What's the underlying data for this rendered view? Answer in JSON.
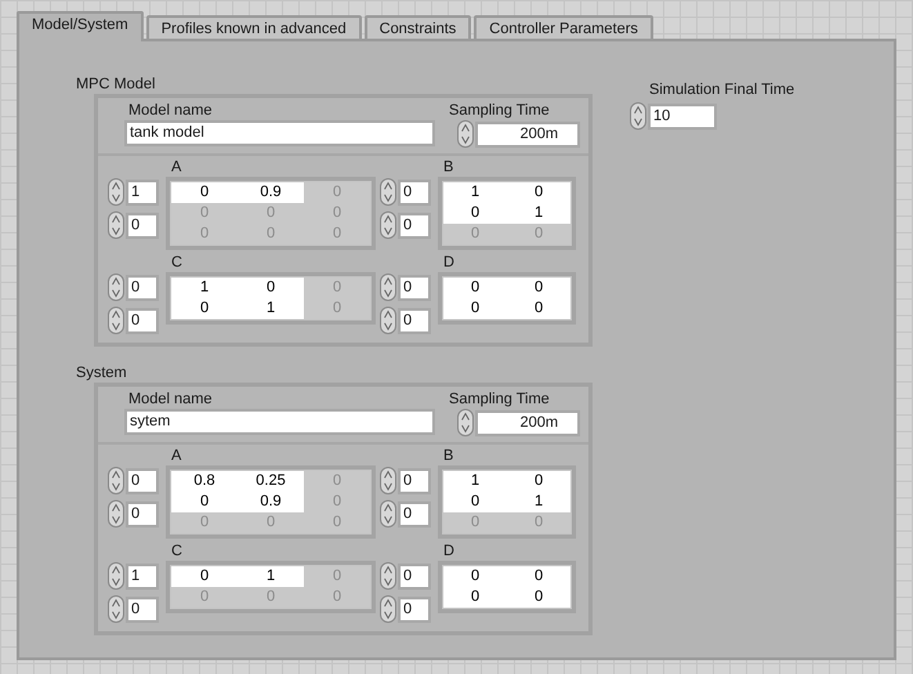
{
  "tabs": [
    {
      "label": "Model/System",
      "selected": true
    },
    {
      "label": "Profiles known in advanced",
      "selected": false
    },
    {
      "label": "Constraints",
      "selected": false
    },
    {
      "label": "Controller Parameters",
      "selected": false
    }
  ],
  "clusters": [
    {
      "title": "MPC Model",
      "model_name_label": "Model name",
      "model_name": "tank model",
      "sampling_label": "Sampling Time",
      "sampling_time": "200m",
      "matrices": [
        {
          "name": "A",
          "indices": [
            "1",
            "0"
          ],
          "rows": [
            [
              {
                "value": "0",
                "active": true
              },
              {
                "value": "0.9",
                "active": true
              },
              {
                "value": "0",
                "active": false
              }
            ],
            [
              {
                "value": "0",
                "active": false
              },
              {
                "value": "0",
                "active": false
              },
              {
                "value": "0",
                "active": false
              }
            ],
            [
              {
                "value": "0",
                "active": false
              },
              {
                "value": "0",
                "active": false
              },
              {
                "value": "0",
                "active": false
              }
            ]
          ]
        },
        {
          "name": "B",
          "indices": [
            "0",
            "0"
          ],
          "rows": [
            [
              {
                "value": "1",
                "active": true
              },
              {
                "value": "0",
                "active": true
              }
            ],
            [
              {
                "value": "0",
                "active": true
              },
              {
                "value": "1",
                "active": true
              }
            ],
            [
              {
                "value": "0",
                "active": false
              },
              {
                "value": "0",
                "active": false
              }
            ]
          ]
        },
        {
          "name": "C",
          "indices": [
            "0",
            "0"
          ],
          "rows": [
            [
              {
                "value": "1",
                "active": true
              },
              {
                "value": "0",
                "active": true
              },
              {
                "value": "0",
                "active": false
              }
            ],
            [
              {
                "value": "0",
                "active": true
              },
              {
                "value": "1",
                "active": true
              },
              {
                "value": "0",
                "active": false
              }
            ]
          ]
        },
        {
          "name": "D",
          "indices": [
            "0",
            "0"
          ],
          "rows": [
            [
              {
                "value": "0",
                "active": true
              },
              {
                "value": "0",
                "active": true
              }
            ],
            [
              {
                "value": "0",
                "active": true
              },
              {
                "value": "0",
                "active": true
              }
            ]
          ]
        }
      ]
    },
    {
      "title": "System",
      "model_name_label": "Model name",
      "model_name": "sytem",
      "sampling_label": "Sampling Time",
      "sampling_time": "200m",
      "matrices": [
        {
          "name": "A",
          "indices": [
            "0",
            "0"
          ],
          "rows": [
            [
              {
                "value": "0.8",
                "active": true
              },
              {
                "value": "0.25",
                "active": true
              },
              {
                "value": "0",
                "active": false
              }
            ],
            [
              {
                "value": "0",
                "active": true
              },
              {
                "value": "0.9",
                "active": true
              },
              {
                "value": "0",
                "active": false
              }
            ],
            [
              {
                "value": "0",
                "active": false
              },
              {
                "value": "0",
                "active": false
              },
              {
                "value": "0",
                "active": false
              }
            ]
          ]
        },
        {
          "name": "B",
          "indices": [
            "0",
            "0"
          ],
          "rows": [
            [
              {
                "value": "1",
                "active": true
              },
              {
                "value": "0",
                "active": true
              }
            ],
            [
              {
                "value": "0",
                "active": true
              },
              {
                "value": "1",
                "active": true
              }
            ],
            [
              {
                "value": "0",
                "active": false
              },
              {
                "value": "0",
                "active": false
              }
            ]
          ]
        },
        {
          "name": "C",
          "indices": [
            "1",
            "0"
          ],
          "rows": [
            [
              {
                "value": "0",
                "active": true
              },
              {
                "value": "1",
                "active": true
              },
              {
                "value": "0",
                "active": false
              }
            ],
            [
              {
                "value": "0",
                "active": false
              },
              {
                "value": "0",
                "active": false
              },
              {
                "value": "0",
                "active": false
              }
            ]
          ]
        },
        {
          "name": "D",
          "indices": [
            "0",
            "0"
          ],
          "rows": [
            [
              {
                "value": "0",
                "active": true
              },
              {
                "value": "0",
                "active": true
              }
            ],
            [
              {
                "value": "0",
                "active": true
              },
              {
                "value": "0",
                "active": true
              }
            ]
          ]
        }
      ]
    }
  ],
  "simulation": {
    "label": "Simulation Final Time",
    "value": "10"
  }
}
